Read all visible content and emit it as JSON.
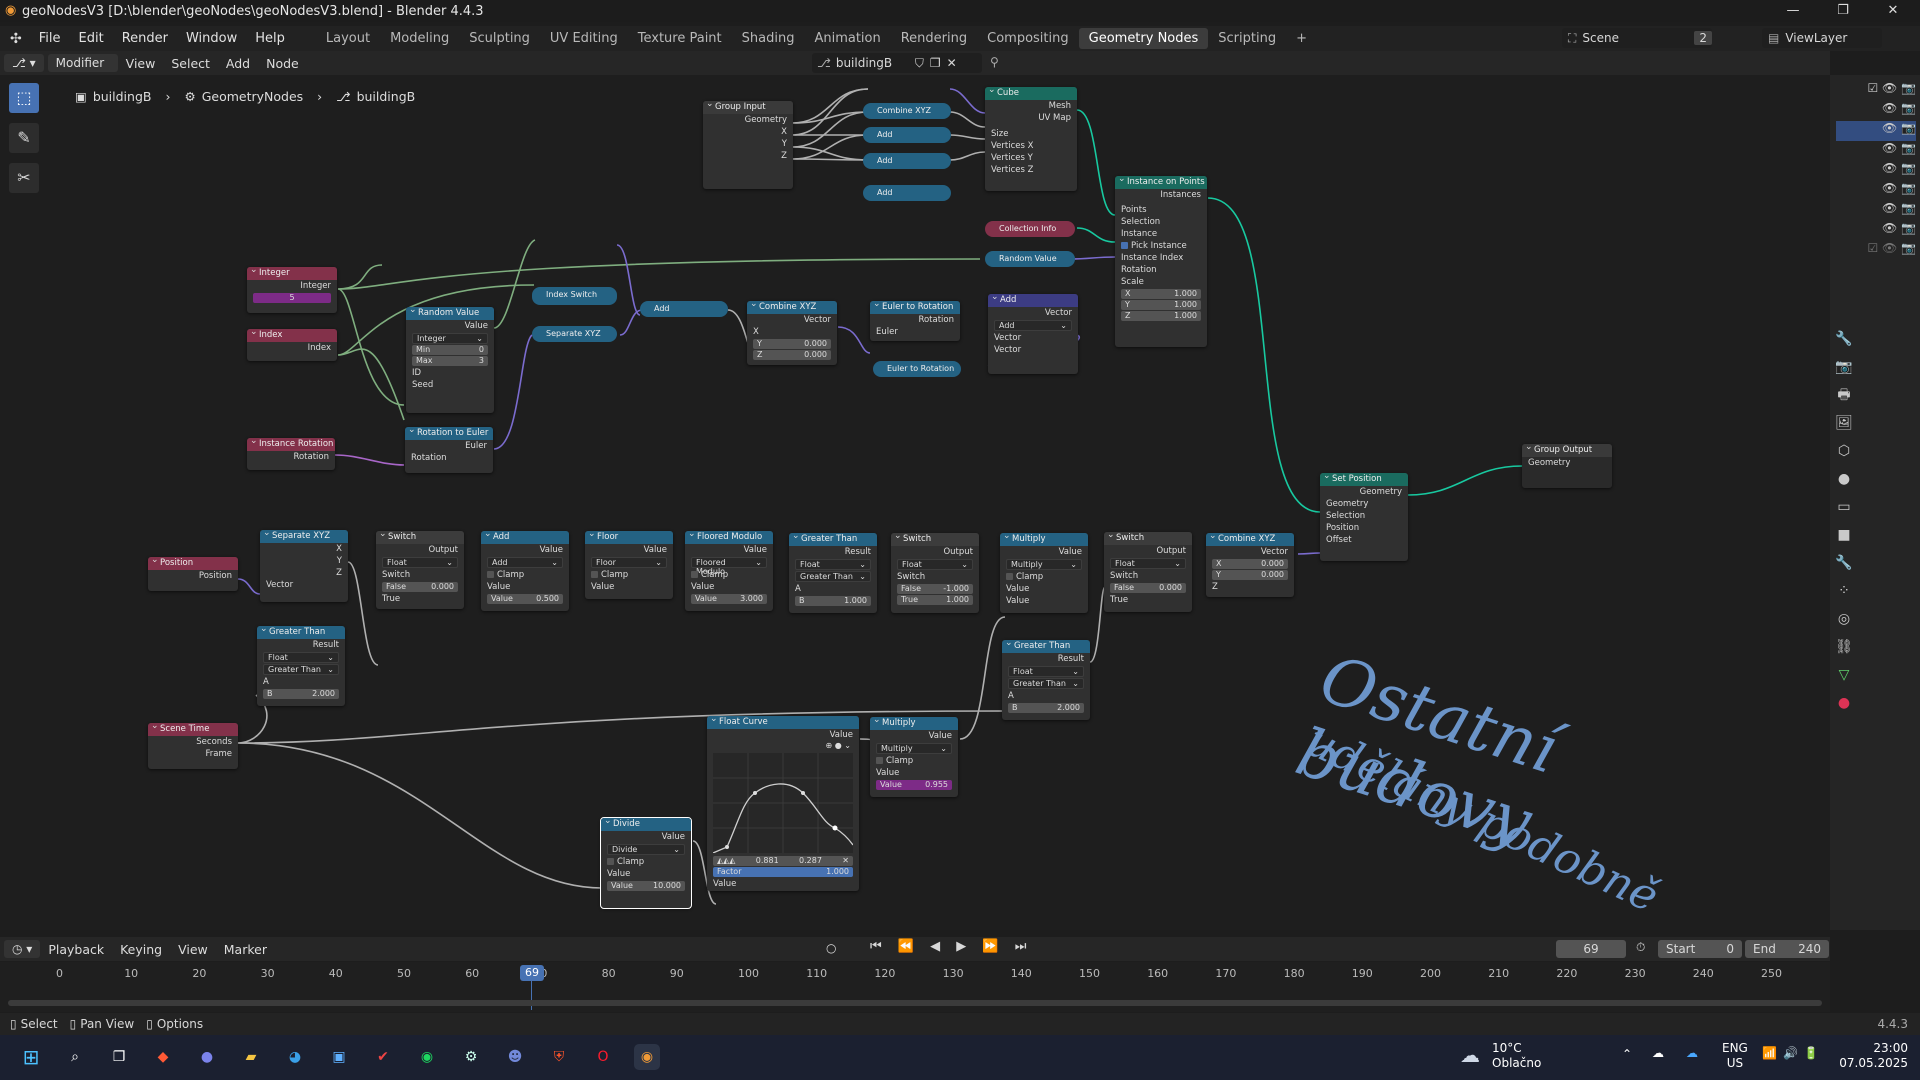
{
  "window": {
    "title": "geoNodesV3 [D:\\blender\\geoNodes\\geoNodesV3.blend] - Blender 4.4.3"
  },
  "menu": {
    "items": [
      "File",
      "Edit",
      "Render",
      "Window",
      "Help"
    ]
  },
  "workspaces": {
    "tabs": [
      "Layout",
      "Modeling",
      "Sculpting",
      "UV Editing",
      "Texture Paint",
      "Shading",
      "Animation",
      "Rendering",
      "Compositing",
      "Geometry Nodes",
      "Scripting"
    ],
    "active": "Geometry Nodes"
  },
  "topright": {
    "scene": "Scene",
    "scene_count": "2",
    "view_layer": "ViewLayer"
  },
  "editor_header": {
    "mode": "Modifier",
    "view": "View",
    "select": "Select",
    "add": "Add",
    "node": "Node",
    "tree_name": "buildingB"
  },
  "breadcrumb": {
    "object": "buildingB",
    "modifier": "GeometryNodes",
    "tree": "buildingB"
  },
  "nodes": {
    "group_input": {
      "title": "Group Input",
      "outs": [
        "Geometry",
        "X",
        "Y",
        "Z"
      ]
    },
    "cube": {
      "title": "Cube",
      "outs": [
        "Mesh",
        "UV Map"
      ],
      "ins": [
        "Size",
        "Vertices X",
        "Vertices Y",
        "Vertices Z"
      ]
    },
    "combine_xyz_pill": "Combine XYZ",
    "add_pill": "Add",
    "instance_on_points": {
      "title": "Instance on Points",
      "out": "Instances",
      "ins": [
        "Points",
        "Selection",
        "Instance",
        "Pick Instance",
        "Instance Index",
        "Rotation",
        "Scale"
      ],
      "scale": [
        [
          "X",
          "1.000"
        ],
        [
          "Y",
          "1.000"
        ],
        [
          "Z",
          "1.000"
        ]
      ]
    },
    "collection_info": "Collection Info",
    "random_value_pill": "Random Value",
    "integer": {
      "title": "Integer",
      "out": "Integer",
      "value": "5"
    },
    "index": {
      "title": "Index",
      "out": "Index"
    },
    "random_value": {
      "title": "Random Value",
      "out": "Value",
      "type": "Integer",
      "min_l": "Min",
      "min": "0",
      "max_l": "Max",
      "max": "3",
      "id": "ID",
      "seed": "Seed"
    },
    "index_switch": "Index Switch",
    "separate_xyz_pill": "Separate XYZ",
    "combine_xyz": {
      "title": "Combine XYZ",
      "out": "Vector",
      "x": "X",
      "y_l": "Y",
      "y": "0.000",
      "z_l": "Z",
      "z": "0.000"
    },
    "euler_to_rotation": {
      "title": "Euler to Rotation",
      "out": "Rotation",
      "in": "Euler"
    },
    "euler_to_rotation_pill": "Euler to Rotation",
    "add_vec": {
      "title": "Add",
      "out": "Vector",
      "op": "Add",
      "ins": [
        "Vector",
        "Vector"
      ]
    },
    "instance_rotation": {
      "title": "Instance Rotation",
      "out": "Rotation"
    },
    "rotation_to_euler": {
      "title": "Rotation to Euler",
      "out": "Euler",
      "in": "Rotation"
    },
    "group_output": {
      "title": "Group Output",
      "in": "Geometry"
    },
    "set_position": {
      "title": "Set Position",
      "out": "Geometry",
      "ins": [
        "Geometry",
        "Selection",
        "Position",
        "Offset"
      ]
    },
    "position": {
      "title": "Position",
      "out": "Position"
    },
    "separate_xyz": {
      "title": "Separate XYZ",
      "outs": [
        "X",
        "Y",
        "Z"
      ],
      "in": "Vector"
    },
    "greater_than_1": {
      "title": "Greater Than",
      "out": "Result",
      "type": "Float",
      "mode": "Greater Than",
      "a": "A",
      "b_l": "B",
      "b": "2.000"
    },
    "switch_1": {
      "title": "Switch",
      "out": "Output",
      "type": "Float",
      "sw": "Switch",
      "false_l": "False",
      "false": "0.000",
      "true": "True"
    },
    "add_f": {
      "title": "Add",
      "out": "Value",
      "op": "Add",
      "clamp": "Clamp",
      "value_in": "Value",
      "v_l": "Value",
      "v": "0.500"
    },
    "floor": {
      "title": "Floor",
      "out": "Value",
      "op": "Floor",
      "clamp": "Clamp",
      "value_in": "Value"
    },
    "floored_modulo": {
      "title": "Floored Modulo",
      "out": "Value",
      "op": "Floored Modulo",
      "clamp": "Clamp",
      "value_in": "Value",
      "v_l": "Value",
      "v": "3.000"
    },
    "greater_than_2": {
      "title": "Greater Than",
      "out": "Result",
      "type": "Float",
      "mode": "Greater Than",
      "a": "A",
      "b_l": "B",
      "b": "1.000"
    },
    "switch_2": {
      "title": "Switch",
      "out": "Output",
      "type": "Float",
      "sw": "Switch",
      "false_l": "False",
      "false": "-1.000",
      "true_l": "True",
      "true": "1.000"
    },
    "multiply_1": {
      "title": "Multiply",
      "out": "Value",
      "op": "Multiply",
      "clamp": "Clamp",
      "ins": [
        "Value",
        "Value"
      ]
    },
    "switch_3": {
      "title": "Switch",
      "out": "Output",
      "type": "Float",
      "sw": "Switch",
      "false_l": "False",
      "false": "0.000",
      "true": "True"
    },
    "combine_xyz_2": {
      "title": "Combine XYZ",
      "out": "Vector",
      "x_l": "X",
      "x": "0.000",
      "y_l": "Y",
      "y": "0.000",
      "z": "Z"
    },
    "greater_than_3": {
      "title": "Greater Than",
      "out": "Result",
      "type": "Float",
      "mode": "Greater Than",
      "a": "A",
      "b_l": "B",
      "b": "2.000"
    },
    "scene_time": {
      "title": "Scene Time",
      "outs": [
        "Seconds",
        "Frame"
      ]
    },
    "float_curve": {
      "title": "Float Curve",
      "out": "Value",
      "x": "0.881",
      "y": "0.287",
      "factor_l": "Factor",
      "factor": "1.000",
      "in": "Value"
    },
    "multiply_2": {
      "title": "Multiply",
      "out": "Value",
      "op": "Multiply",
      "clamp": "Clamp",
      "in": "Value",
      "v_l": "Value",
      "v": "0.955"
    },
    "divide": {
      "title": "Divide",
      "out": "Value",
      "op": "Divide",
      "clamp": "Clamp",
      "in": "Value",
      "v_l": "Value",
      "v": "10.000"
    }
  },
  "annotation": {
    "line1": "Ostatní budovy",
    "line2": "udělány podobně"
  },
  "timeline": {
    "playback": "Playback",
    "keying": "Keying",
    "view": "View",
    "marker": "Marker",
    "current": "69",
    "start_l": "Start",
    "start": "0",
    "end_l": "End",
    "end": "240",
    "ticks": [
      "0",
      "10",
      "20",
      "30",
      "40",
      "50",
      "60",
      "70",
      "80",
      "90",
      "100",
      "110",
      "120",
      "130",
      "140",
      "150",
      "160",
      "170",
      "180",
      "190",
      "200",
      "210",
      "220",
      "230",
      "240",
      "250"
    ]
  },
  "status": {
    "select": "Select",
    "pan": "Pan View",
    "options": "Options",
    "version": "4.4.3"
  },
  "taskbar": {
    "weather_temp": "10°C",
    "weather_desc": "Oblačno",
    "lang1": "ENG",
    "lang2": "US",
    "time": "23:00",
    "date": "07.05.2025"
  }
}
